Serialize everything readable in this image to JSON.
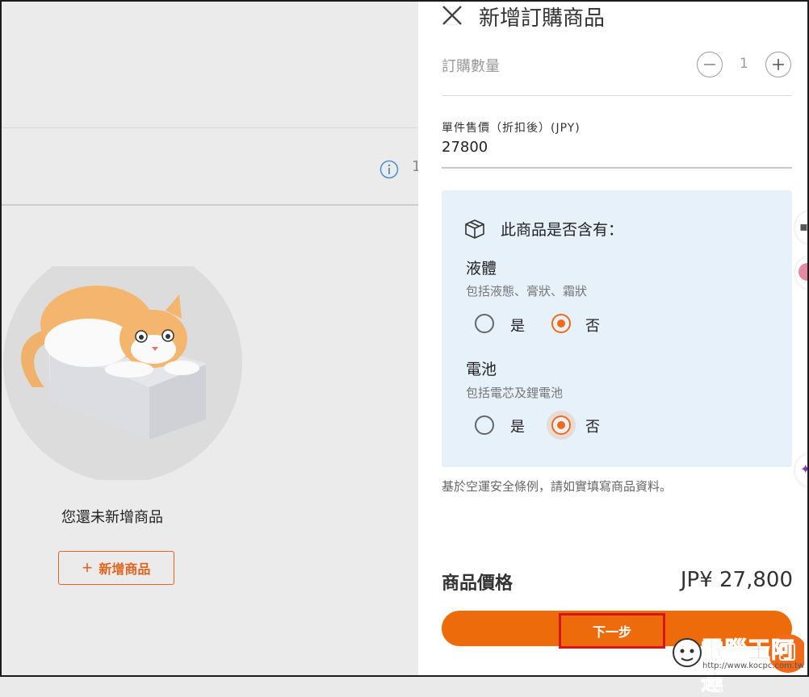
{
  "background": {
    "empty_text": "您還未新增商品",
    "add_product_label": "新增商品",
    "cut_glyph": "1"
  },
  "drawer": {
    "title": "新增訂購商品",
    "quantity": {
      "label": "訂購數量",
      "value": "1"
    },
    "unit_price": {
      "label": "單件售價（折扣後）(JPY)",
      "value": "27800"
    },
    "info_box": {
      "heading": "此商品是否含有：",
      "sections": [
        {
          "title": "液體",
          "subtitle": "包括液態、膏狀、霜狀",
          "yes": "是",
          "no": "否",
          "selected": "no"
        },
        {
          "title": "電池",
          "subtitle": "包括電芯及鋰電池",
          "yes": "是",
          "no": "否",
          "selected": "no"
        }
      ]
    },
    "note": "基於空運安全條例，請如實填寫商品資料。",
    "total": {
      "label": "商品價格",
      "value": "JP¥ 27,800"
    },
    "next_label": "下一步"
  },
  "watermark": {
    "text": "電腦王阿達",
    "url": "http://www.kocpc.com.tw"
  },
  "colors": {
    "accent": "#ee6b0b",
    "highlight_box": "#d4171a",
    "info_bg": "#e7f1f9"
  }
}
